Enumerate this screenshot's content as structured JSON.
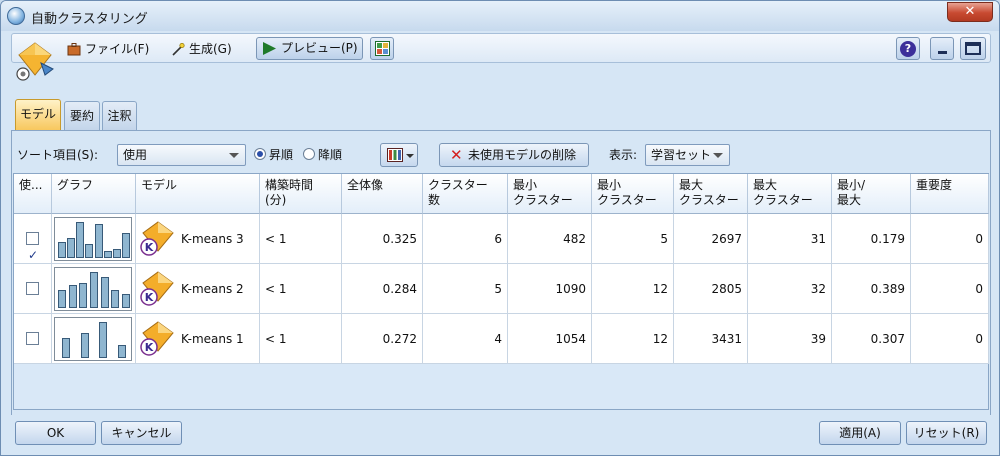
{
  "window": {
    "title": "自動クラスタリング",
    "close_label": "✕"
  },
  "toolbar": {
    "file_label": "ファイル(F)",
    "generate_label": "生成(G)",
    "preview_label": "プレビュー(P)",
    "help_label": "?"
  },
  "tabs": [
    {
      "label": "モデル",
      "active": true
    },
    {
      "label": "要約",
      "active": false
    },
    {
      "label": "注釈",
      "active": false
    }
  ],
  "options": {
    "sort_label": "ソート項目(S):",
    "sort_value": "使用",
    "ascending_label": "昇順",
    "descending_label": "降順",
    "delete_unused_label": "未使用モデルの削除",
    "view_label": "表示:",
    "view_value": "学習セット"
  },
  "table": {
    "headers": [
      "使...",
      "グラフ",
      "モデル",
      "構築時間\n(分)",
      "全体像",
      "クラスター\n数",
      "最小\nクラスター",
      "最小\nクラスター",
      "最大\nクラスター",
      "最大\nクラスター",
      "最小/\n最大",
      "重要度"
    ],
    "rows": [
      {
        "use": true,
        "model": "K-means 3",
        "build_time": "< 1",
        "overall": "0.325",
        "num_clusters": "6",
        "min_cluster_size": "482",
        "min_cluster_pct": "5",
        "max_cluster_size": "2697",
        "max_cluster_pct": "31",
        "min_max": "0.179",
        "importance": "0",
        "bars": [
          0.45,
          0.55,
          1.0,
          0.4,
          0.95,
          0.2,
          0.25,
          0.7
        ]
      },
      {
        "use": false,
        "model": "K-means 2",
        "build_time": "< 1",
        "overall": "0.284",
        "num_clusters": "5",
        "min_cluster_size": "1090",
        "min_cluster_pct": "12",
        "max_cluster_size": "2805",
        "max_cluster_pct": "32",
        "min_max": "0.389",
        "importance": "0",
        "bars": [
          0.5,
          0.65,
          0.7,
          1.0,
          0.85,
          0.5,
          0.4
        ]
      },
      {
        "use": false,
        "model": "K-means 1",
        "build_time": "< 1",
        "overall": "0.272",
        "num_clusters": "4",
        "min_cluster_size": "1054",
        "min_cluster_pct": "12",
        "max_cluster_size": "3431",
        "max_cluster_pct": "39",
        "min_max": "0.307",
        "importance": "0",
        "bars": [
          0.55,
          0.7,
          1.0,
          0.35
        ]
      }
    ]
  },
  "buttons": {
    "ok": "OK",
    "cancel": "キャンセル",
    "apply": "適用(A)",
    "reset": "リセット(R)"
  }
}
